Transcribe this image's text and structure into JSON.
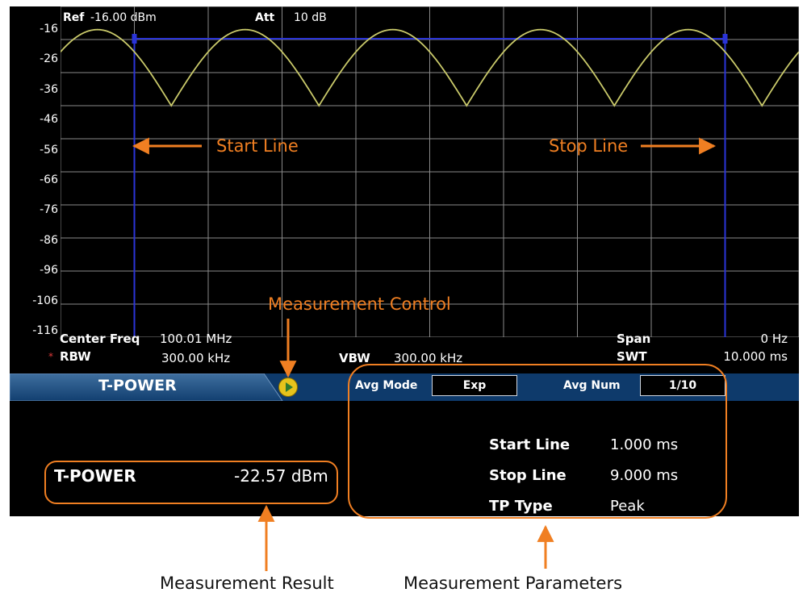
{
  "header": {
    "ref_label": "Ref",
    "ref_value": "-16.00 dBm",
    "att_label": "Att",
    "att_value": "10 dB"
  },
  "y_axis": {
    "ticks": [
      "-16",
      "-26",
      "-36",
      "-46",
      "-56",
      "-66",
      "-76",
      "-86",
      "-96",
      "-106",
      "-116"
    ]
  },
  "chart_data": {
    "type": "line",
    "ylim": [
      -116,
      -16
    ],
    "y_ticks": [
      -16,
      -26,
      -36,
      -46,
      -56,
      -66,
      -76,
      -86,
      -96,
      -106,
      -116
    ],
    "x_range_ms": [
      0,
      10
    ],
    "series": [
      {
        "x": [
          0,
          0.5,
          1,
          1.5,
          2,
          2.5,
          3,
          3.5,
          4,
          4.5,
          5,
          5.5,
          6,
          6.5,
          7,
          7.5,
          8,
          8.5,
          9,
          9.5,
          10
        ],
        "values": [
          -36,
          -23,
          -30,
          -46,
          -30,
          -23,
          -30,
          -46,
          -30,
          -23,
          -30,
          -46,
          -30,
          -23,
          -30,
          -46,
          -30,
          -23,
          -30,
          -46,
          -36
        ]
      }
    ],
    "start_line_ms": 1.0,
    "stop_line_ms": 9.0,
    "colors": {
      "trace": "#c9c96a",
      "lines": "#2a34d8",
      "grid": "#8a8a8a"
    }
  },
  "info": {
    "center_freq_label": "Center Freq",
    "center_freq_value": "100.01 MHz",
    "span_label": "Span",
    "span_value": "0 Hz",
    "rbw_marker": "*",
    "rbw_label": "RBW",
    "rbw_value": "300.00 kHz",
    "vbw_label": "VBW",
    "vbw_value": "300.00 kHz",
    "swt_label": "SWT",
    "swt_value": "10.000 ms"
  },
  "menu": {
    "tab_label": "T-POWER",
    "avg_mode_label": "Avg Mode",
    "avg_mode_value": "Exp",
    "avg_num_label": "Avg Num",
    "avg_num_value": "1/10"
  },
  "result": {
    "label": "T-POWER",
    "value": "-22.57 dBm"
  },
  "params": [
    {
      "label": "Start Line",
      "value": "1.000 ms"
    },
    {
      "label": "Stop Line",
      "value": "9.000 ms"
    },
    {
      "label": "TP Type",
      "value": "Peak"
    }
  ],
  "annotations": {
    "start_line": "Start Line",
    "stop_line": "Stop Line",
    "measurement_control": "Measurement Control",
    "measurement_result": "Measurement Result",
    "measurement_parameters": "Measurement Parameters"
  },
  "colors": {
    "annotation": "#f07f22",
    "menubar": "#0e3a6b"
  }
}
